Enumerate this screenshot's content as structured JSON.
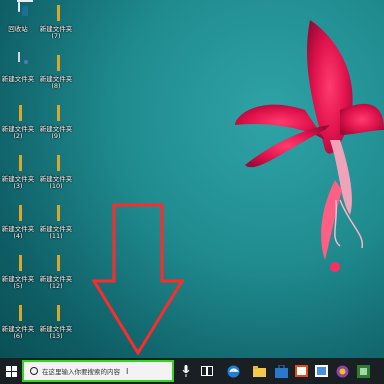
{
  "desktop": {
    "icons": [
      {
        "label": "回收站",
        "type": "bin"
      },
      {
        "label": "新建文件夹\n(7)",
        "type": "folder"
      },
      {
        "label": "新建文件夹",
        "type": "file"
      },
      {
        "label": "新建文件夹\n(8)",
        "type": "folder"
      },
      {
        "label": "新建文件夹\n(2)",
        "type": "folder"
      },
      {
        "label": "新建文件夹\n(9)",
        "type": "folder"
      },
      {
        "label": "新建文件夹\n(3)",
        "type": "folder"
      },
      {
        "label": "新建文件夹\n(10)",
        "type": "folder"
      },
      {
        "label": "新建文件夹\n(4)",
        "type": "folder"
      },
      {
        "label": "新建文件夹\n(11)",
        "type": "folder"
      },
      {
        "label": "新建文件夹\n(5)",
        "type": "folder"
      },
      {
        "label": "新建文件夹\n(12)",
        "type": "folder"
      },
      {
        "label": "新建文件夹\n(6)",
        "type": "folder"
      },
      {
        "label": "新建文件夹\n(13)",
        "type": "folder"
      }
    ]
  },
  "annotation": {
    "arrow_color": "#ff2b2b",
    "highlight_color": "#33d61f"
  },
  "taskbar": {
    "start_icon": "windows-logo-icon",
    "search_placeholder": "在这里输入你要搜索的内容",
    "items": [
      "mic-icon",
      "task-view-icon",
      "edge-icon",
      "explorer-icon",
      "store-icon",
      "app-icon-1",
      "app-icon-2",
      "app-icon-3",
      "app-icon-4"
    ]
  }
}
